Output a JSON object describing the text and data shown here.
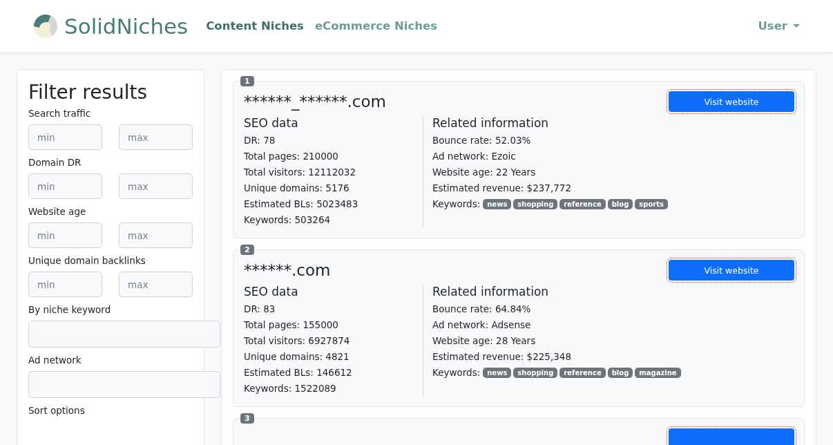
{
  "brand": {
    "name": "SolidNiches"
  },
  "nav": [
    {
      "label": "Content Niches",
      "selected": true
    },
    {
      "label": "eCommerce Niches",
      "selected": false
    }
  ],
  "user_menu": {
    "label": "User"
  },
  "filters": {
    "title": "Filter results",
    "ranges": [
      {
        "label": "Search traffic",
        "min_placeholder": "min",
        "max_placeholder": "max"
      },
      {
        "label": "Domain DR",
        "min_placeholder": "min",
        "max_placeholder": "max"
      },
      {
        "label": "Website age",
        "min_placeholder": "min",
        "max_placeholder": "max"
      },
      {
        "label": "Unique domain backlinks",
        "min_placeholder": "min",
        "max_placeholder": "max"
      }
    ],
    "text_fields": [
      {
        "label": "By niche keyword"
      },
      {
        "label": "Ad network"
      }
    ],
    "sort_label": "Sort options"
  },
  "results": [
    {
      "rank": "1",
      "domain": "******_******.com",
      "button": "Visit website",
      "seo_title": "SEO data",
      "seo": [
        "DR: 78",
        "Total pages: 210000",
        "Total visitors: 12112032",
        "Unique domains: 5176",
        "Estimated BLs: 5023483",
        "Keywords: 503264"
      ],
      "info_title": "Related information",
      "info": [
        "Bounce rate: 52.03%",
        "Ad network: Ezoic",
        "Website age: 22 Years",
        "Estimated revenue: $237,772"
      ],
      "keywords_label": "Keywords:",
      "keywords": [
        "news",
        "shopping",
        "reference",
        "blog",
        "sports"
      ]
    },
    {
      "rank": "2",
      "domain": "******.com",
      "button": "Visit website",
      "seo_title": "SEO data",
      "seo": [
        "DR: 83",
        "Total pages: 155000",
        "Total visitors: 6927874",
        "Unique domains: 4821",
        "Estimated BLs: 146612",
        "Keywords: 1522089"
      ],
      "info_title": "Related information",
      "info": [
        "Bounce rate: 64.84%",
        "Ad network: Adsense",
        "Website age: 28 Years",
        "Estimated revenue: $225,348"
      ],
      "keywords_label": "Keywords:",
      "keywords": [
        "news",
        "shopping",
        "reference",
        "blog",
        "magazine"
      ]
    },
    {
      "rank": "3"
    }
  ]
}
